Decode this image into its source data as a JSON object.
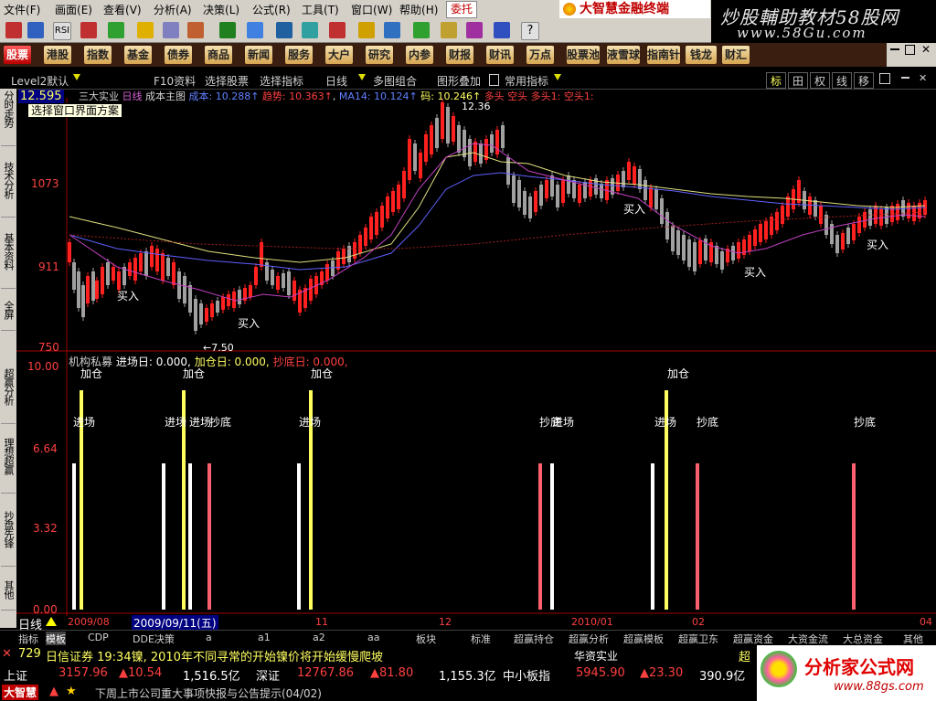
{
  "menu": [
    "文件",
    "画面",
    "查看",
    "分析",
    "决策",
    "公式",
    "工具",
    "窗口",
    "帮助"
  ],
  "menu_keys": [
    "(F)",
    "(E)",
    "(V)",
    "(A)",
    "(L)",
    "(R)",
    "(T)",
    "(W)",
    "(H)"
  ],
  "weituo_label": "委托",
  "brand_title": "大智慧金融终端",
  "watermark": {
    "line1": "炒股輔助教材58股网",
    "line2": "www.58Gu.com"
  },
  "function_tabs": [
    "股票",
    "港股",
    "指数",
    "基金",
    "债券",
    "商品",
    "新闻",
    "服务",
    "大户室",
    "研究室",
    "内参",
    "财报",
    "财讯",
    "万点",
    "股票池",
    "液雪球",
    "指南针",
    "钱龙",
    "财汇"
  ],
  "sub_toolbar": {
    "level2": "Level2默认",
    "f10": "F10资料",
    "select_stock": "选择股票",
    "select_indicator": "选择指标",
    "period": "日线",
    "multi_chart": "多图组合",
    "overlay": "图形叠加",
    "common_indicator": "常用指标",
    "right_tabs": [
      "标",
      "田",
      "权",
      "线",
      "移"
    ]
  },
  "left_tabs": [
    "分时走势",
    "技术分析",
    "基本资料",
    "全屏",
    "超赢分析",
    "理想超赢",
    "抄盘先锋",
    "其他"
  ],
  "chart_info": {
    "price_now": "12.595",
    "stock_name": "三大实业",
    "period": "日线",
    "cost_main": "成本主图",
    "cost_label": "成本: 10.288↑",
    "trend_label": "趋势: 10.363↑",
    "ma14_label": "MA14: 10.124↑",
    "chip_label": "码: 10.246↑",
    "multi_head": "多头",
    "empty_head": "空头",
    "multi_head1": "多头1:",
    "empty_head1": "空头1:",
    "tooltip": "选择窗口界面方案",
    "high_label": "12.36",
    "low_label": "←7.50",
    "buy_label": "买入"
  },
  "price_axis": [
    "1073",
    "911",
    "750"
  ],
  "ind_info": {
    "name": "机构私募",
    "entry": "进场日: 0.000,",
    "add": "加仓日: 0.000,",
    "bottom": "抄底日: 0.000,"
  },
  "ind_axis": [
    "10.00",
    "6.64",
    "3.32",
    "0.00"
  ],
  "ind_labels": {
    "add": "加仓",
    "entry": "进场",
    "bottom": "抄底"
  },
  "time_axis": {
    "period_label": "日线",
    "date_box": "2009/09/11(五)",
    "ticks": [
      "2009/08",
      "11",
      "12",
      "2010/01",
      "02",
      "04"
    ]
  },
  "bottom_tabs": [
    "指标",
    "模板",
    "CDP",
    "DDE决策",
    "a",
    "a1",
    "a2",
    "aa",
    "板块",
    "标准",
    "超赢持仓",
    "超赢分析",
    "超赢模板",
    "超赢卫东",
    "超赢资金",
    "大资金流",
    "大总资金",
    "其他"
  ],
  "ticker1": {
    "code": "729",
    "news": "日信证券 19:34镍, 2010年不同寻常的开始镍价将开始缓慢爬坡",
    "stock": "华资实业",
    "extra": "超"
  },
  "ticker2": {
    "sh_label": "上证",
    "sh_value": "3157.96",
    "sh_change": "▲10.54",
    "sh_amount": "1,516.5亿",
    "sz_label": "深证",
    "sz_value": "12767.86",
    "sz_change": "▲81.80",
    "sz_amount": "1,155.3亿",
    "sme_label": "中小板指",
    "sme_value": "5945.90",
    "sme_change": "▲23.30",
    "sme_amount": "390.9亿"
  },
  "ticker3": {
    "brand": "大智慧",
    "notice": "下周上市公司重大事项快报与公告提示(04/02)"
  },
  "bl_logo": {
    "line1": "分析家公式网",
    "line2": "www.88gs.com"
  },
  "colors": {
    "up": "#ff2020",
    "down": "#a0a0a0",
    "yellow": "#ffff60",
    "magenta": "#c040c0",
    "blue": "#6060ff",
    "white": "#ffffff"
  }
}
